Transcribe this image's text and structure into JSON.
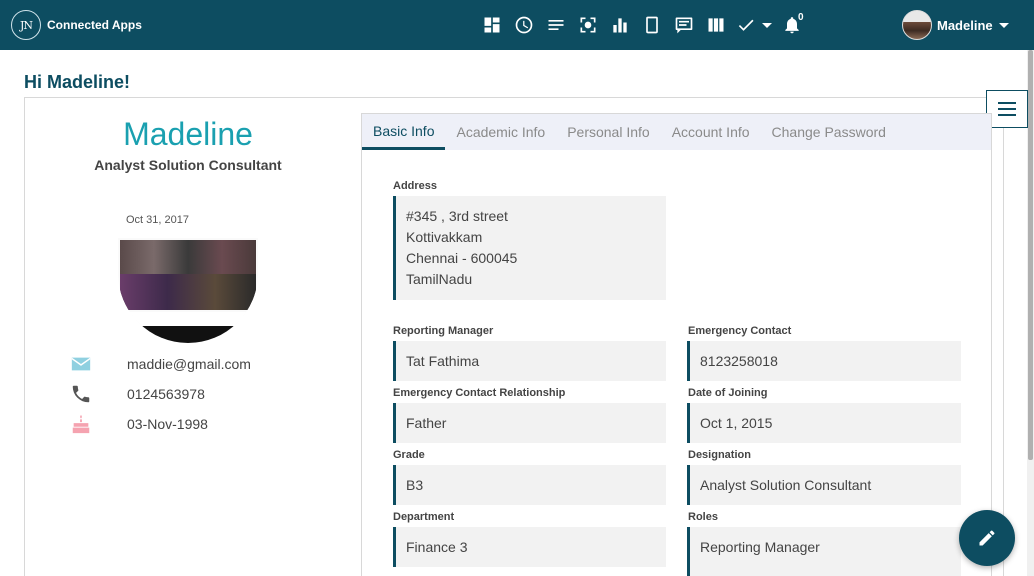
{
  "header": {
    "logo_text": "JN",
    "app_name": "Connected Apps",
    "icons": [
      "dashboard-icon",
      "clock-icon",
      "list-icon",
      "focus-icon",
      "bar-chart-icon",
      "tablet-icon",
      "message-icon",
      "columns-icon",
      "check-icon",
      "bell-icon"
    ],
    "notification_count": "0",
    "user_name": "Madeline"
  },
  "greeting": "Hi Madeline!",
  "profile": {
    "name": "Madeline",
    "title": "Analyst Solution Consultant",
    "photo_date": "Oct 31, 2017",
    "email": "maddie@gmail.com",
    "phone": "0124563978",
    "birthday": "03-Nov-1998"
  },
  "tabs": [
    {
      "label": "Basic Info",
      "active": true
    },
    {
      "label": "Academic Info",
      "active": false
    },
    {
      "label": "Personal Info",
      "active": false
    },
    {
      "label": "Account Info",
      "active": false
    },
    {
      "label": "Change Password",
      "active": false
    }
  ],
  "fields": {
    "address": {
      "label": "Address",
      "lines": [
        "#345 , 3rd street",
        "Kottivakkam",
        "Chennai - 600045",
        "TamilNadu"
      ]
    },
    "reporting_manager": {
      "label": "Reporting Manager",
      "value": "Tat Fathima"
    },
    "emergency_contact": {
      "label": "Emergency Contact",
      "value": "8123258018"
    },
    "emergency_relationship": {
      "label": "Emergency Contact Relationship",
      "value": "Father"
    },
    "date_of_joining": {
      "label": "Date of Joining",
      "value": "Oct 1, 2015"
    },
    "grade": {
      "label": "Grade",
      "value": "B3"
    },
    "designation": {
      "label": "Designation",
      "value": "Analyst Solution Consultant"
    },
    "department": {
      "label": "Department",
      "value": "Finance 3"
    },
    "roles": {
      "label": "Roles",
      "value": "Reporting Manager"
    }
  },
  "colors": {
    "header_bg": "#0d4d61",
    "accent": "#1aa0b0",
    "tab_bg": "#eef0f8",
    "field_bg": "#f2f2f2"
  }
}
